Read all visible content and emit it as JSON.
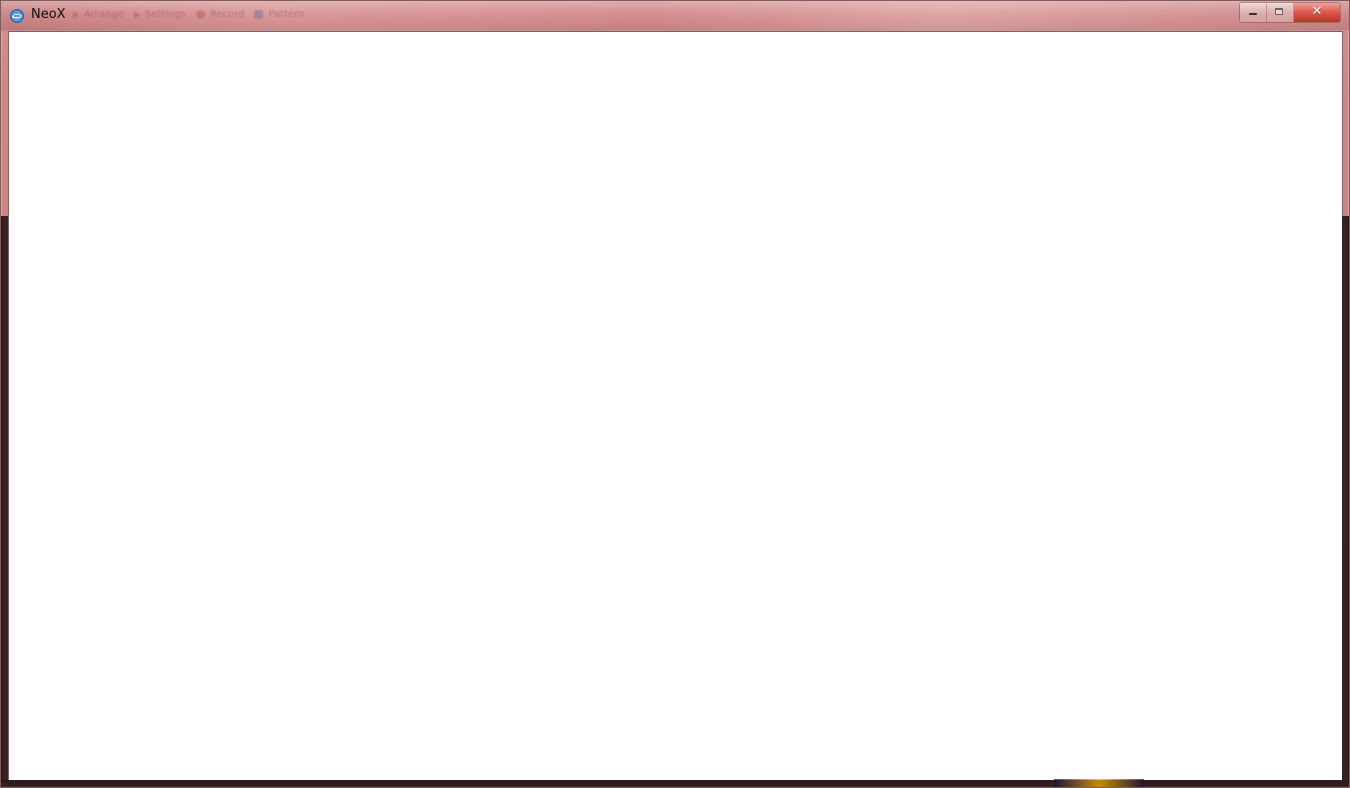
{
  "window": {
    "title": "NeoX"
  },
  "toolbar": {
    "items": [
      {
        "label": "Arrange",
        "icon": "arrow-icon"
      },
      {
        "label": "Settings",
        "icon": "arrow-icon"
      },
      {
        "label": "Record",
        "icon": "record-icon"
      },
      {
        "label": "Pattern",
        "icon": "square-icon"
      }
    ]
  },
  "controls": {
    "minimize": "minimize-icon",
    "maximize": "maximize-icon",
    "close": "close-icon"
  },
  "colors": {
    "titlebar": "#d18787",
    "client_background": "#ffffff",
    "close_button": "#dc5a4c"
  }
}
